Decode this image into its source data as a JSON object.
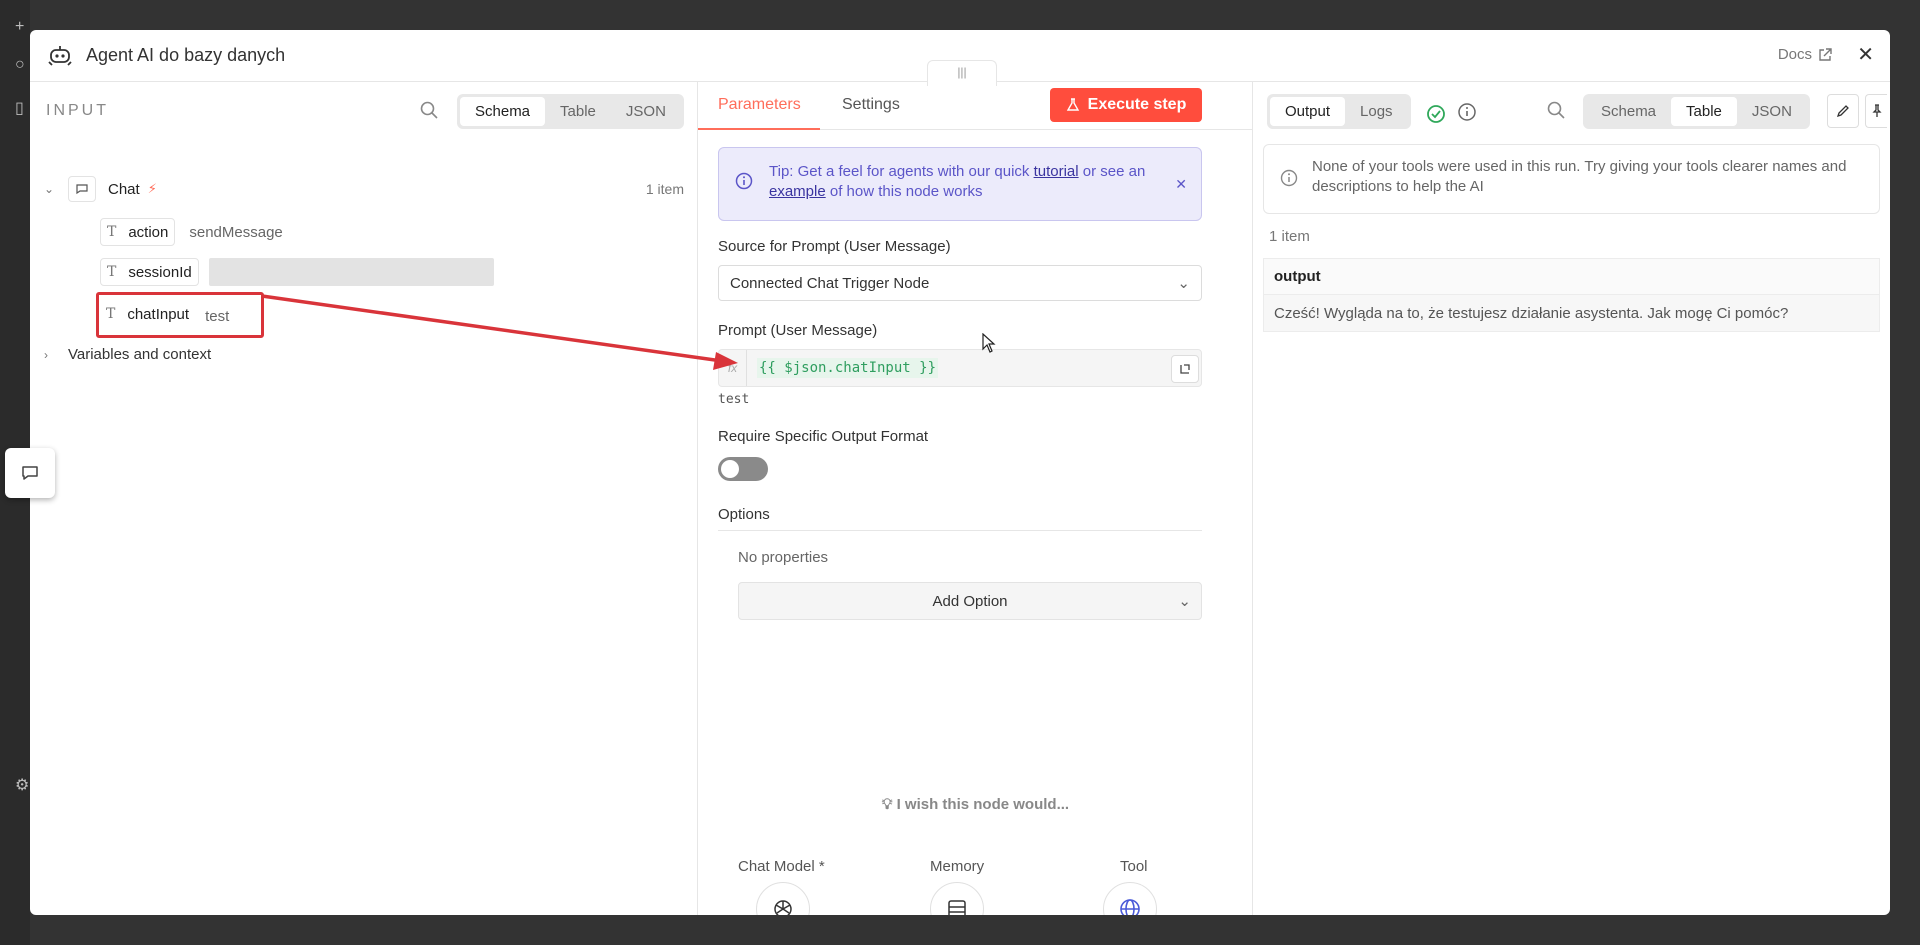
{
  "modal": {
    "title": "Agent AI do bazy danych",
    "docs_label": "Docs"
  },
  "input": {
    "header": "INPUT",
    "views": [
      "Schema",
      "Table",
      "JSON"
    ],
    "active_view": "Schema",
    "node": {
      "name": "Chat",
      "count": "1 item"
    },
    "fields": [
      {
        "type_icon": "T",
        "key": "action",
        "value": "sendMessage"
      },
      {
        "type_icon": "T",
        "key": "sessionId",
        "value": ""
      },
      {
        "type_icon": "T",
        "key": "chatInput",
        "value": "test"
      }
    ],
    "variables_label": "Variables and context"
  },
  "params": {
    "tabs": [
      "Parameters",
      "Settings"
    ],
    "active_tab": "Parameters",
    "execute_label": "Execute step",
    "tip": {
      "prefix": "Tip: Get a feel for agents with our quick ",
      "link1": "tutorial",
      "middle": " or see an ",
      "link2": "example",
      "suffix": " of how this node works"
    },
    "source_label": "Source for Prompt (User Message)",
    "source_value": "Connected Chat Trigger Node",
    "prompt_label": "Prompt (User Message)",
    "prompt_expression": "{{ $json.chatInput }}",
    "prompt_fx": "fx",
    "prompt_preview": "test",
    "require_format_label": "Require Specific Output Format",
    "require_format_enabled": false,
    "options_label": "Options",
    "no_properties": "No properties",
    "add_option_label": "Add Option",
    "wish_label": "I wish this node would...",
    "sub_nodes": [
      "Chat Model *",
      "Memory",
      "Tool"
    ]
  },
  "output": {
    "modes": [
      "Output",
      "Logs"
    ],
    "active_mode": "Output",
    "views": [
      "Schema",
      "Table",
      "JSON"
    ],
    "active_view": "Table",
    "notice": "None of your tools were used in this run. Try giving your tools clearer names and descriptions to help the AI",
    "count": "1 item",
    "column": "output",
    "row_value": "Cześć! Wygląda na to, że testujesz działanie asystenta. Jak mogę Ci pomóc?"
  },
  "colors": {
    "accent": "#ff6d5a",
    "execute": "#ff4d3d",
    "highlight": "#d9343a",
    "tip_text": "#5b55c8",
    "success": "#2fa85a"
  }
}
